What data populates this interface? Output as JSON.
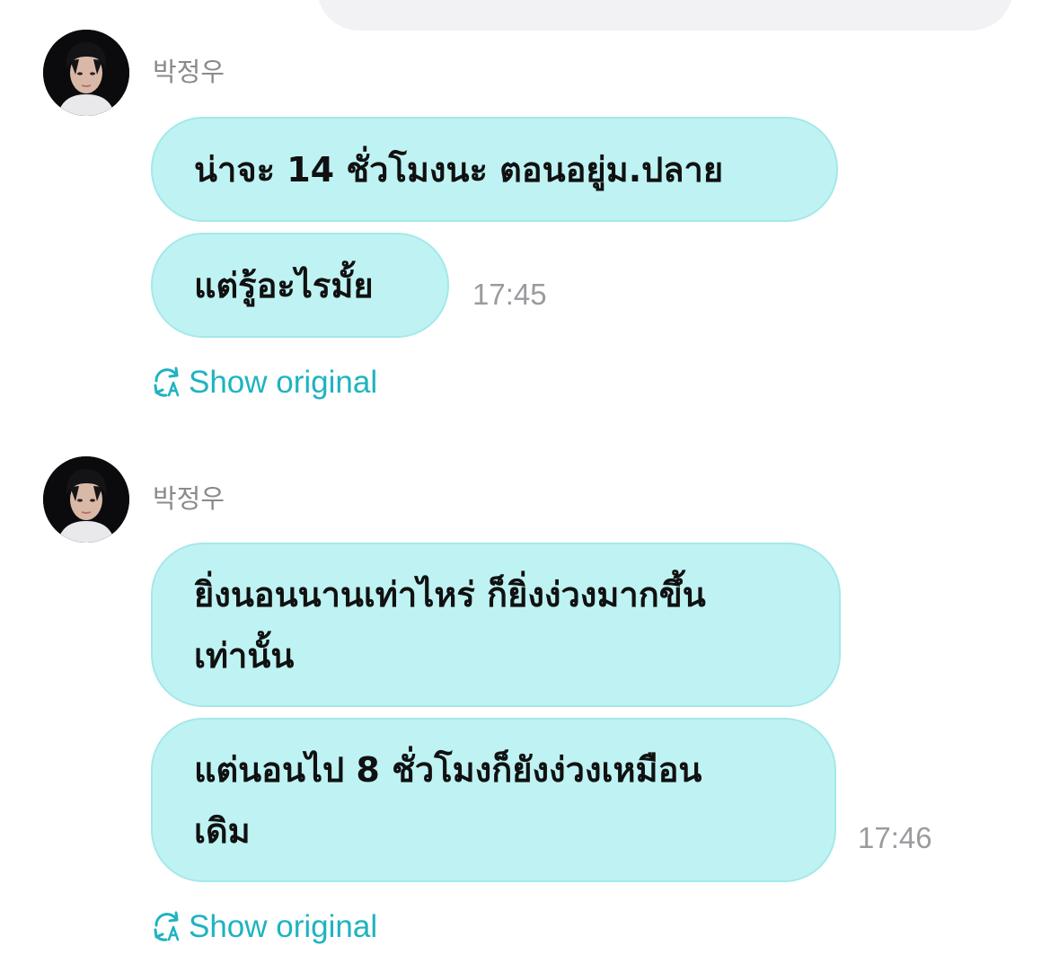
{
  "messages": [
    {
      "sender": "박정우",
      "bubbles": [
        {
          "lines": [
            "น่าจะ 14 ชั่วโมงนะ ตอนอยู่ม.ปลาย"
          ]
        },
        {
          "lines": [
            "แต่รู้อะไรมั้ย"
          ],
          "time": "17:45"
        }
      ],
      "action": "Show original"
    },
    {
      "sender": "박정우",
      "bubbles": [
        {
          "lines": [
            "ยิ่งนอนนานเท่าไหร่ ก็ยิ่งง่วงมากขึ้น",
            "เท่านั้น"
          ]
        },
        {
          "lines": [
            "แต่นอนไป 8 ชั่วโมงก็ยังง่วงเหมือน",
            "เดิม"
          ],
          "time": "17:46"
        }
      ],
      "action": "Show original"
    }
  ],
  "colors": {
    "bubble": "#bff3f3",
    "bubble_border": "#a4e8ea",
    "accent": "#1fb3c0",
    "muted": "#8a8a8e"
  },
  "icons": {
    "translate": "translate-refresh-icon",
    "avatar": "profile-photo"
  }
}
